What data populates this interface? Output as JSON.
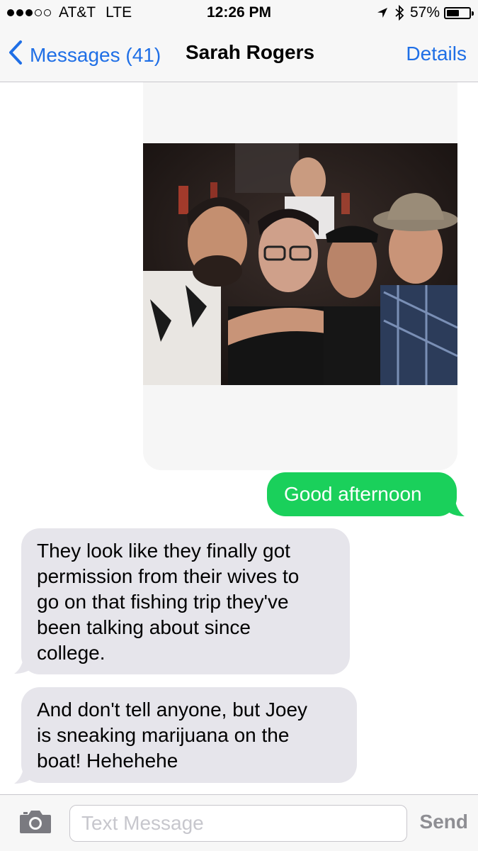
{
  "status_bar": {
    "carrier": "AT&T",
    "network": "LTE",
    "time": "12:26 PM",
    "battery_percent_label": "57%",
    "battery_level": 0.57,
    "signal_bars_filled": 3,
    "signal_bars_total": 5
  },
  "nav": {
    "back_label": "Messages (41)",
    "title": "Sarah Rogers",
    "details_label": "Details"
  },
  "messages": [
    {
      "type": "image",
      "direction": "sent"
    },
    {
      "type": "text",
      "direction": "sent",
      "lines": [
        "Good afternoon"
      ]
    },
    {
      "type": "text",
      "direction": "received",
      "lines": [
        "They look like they finally got",
        "permission from their wives to",
        "go on that fishing trip they've",
        "been talking about since",
        "college."
      ]
    },
    {
      "type": "text",
      "direction": "received",
      "lines": [
        "And don't tell anyone, but Joey",
        "is sneaking marijuana on the",
        "boat! Hehehehe"
      ]
    }
  ],
  "input": {
    "placeholder": "Text Message",
    "value": "",
    "send_label": "Send"
  },
  "colors": {
    "ios_blue": "#1f6fe6",
    "sent_green": "#1ad05b",
    "received_gray": "#e6e5eb",
    "bar_bg": "#f7f7f7"
  },
  "icons": {
    "back": "chevron-left-icon",
    "location": "location-arrow-icon",
    "bluetooth": "bluetooth-icon",
    "battery": "battery-icon",
    "camera": "camera-icon"
  }
}
